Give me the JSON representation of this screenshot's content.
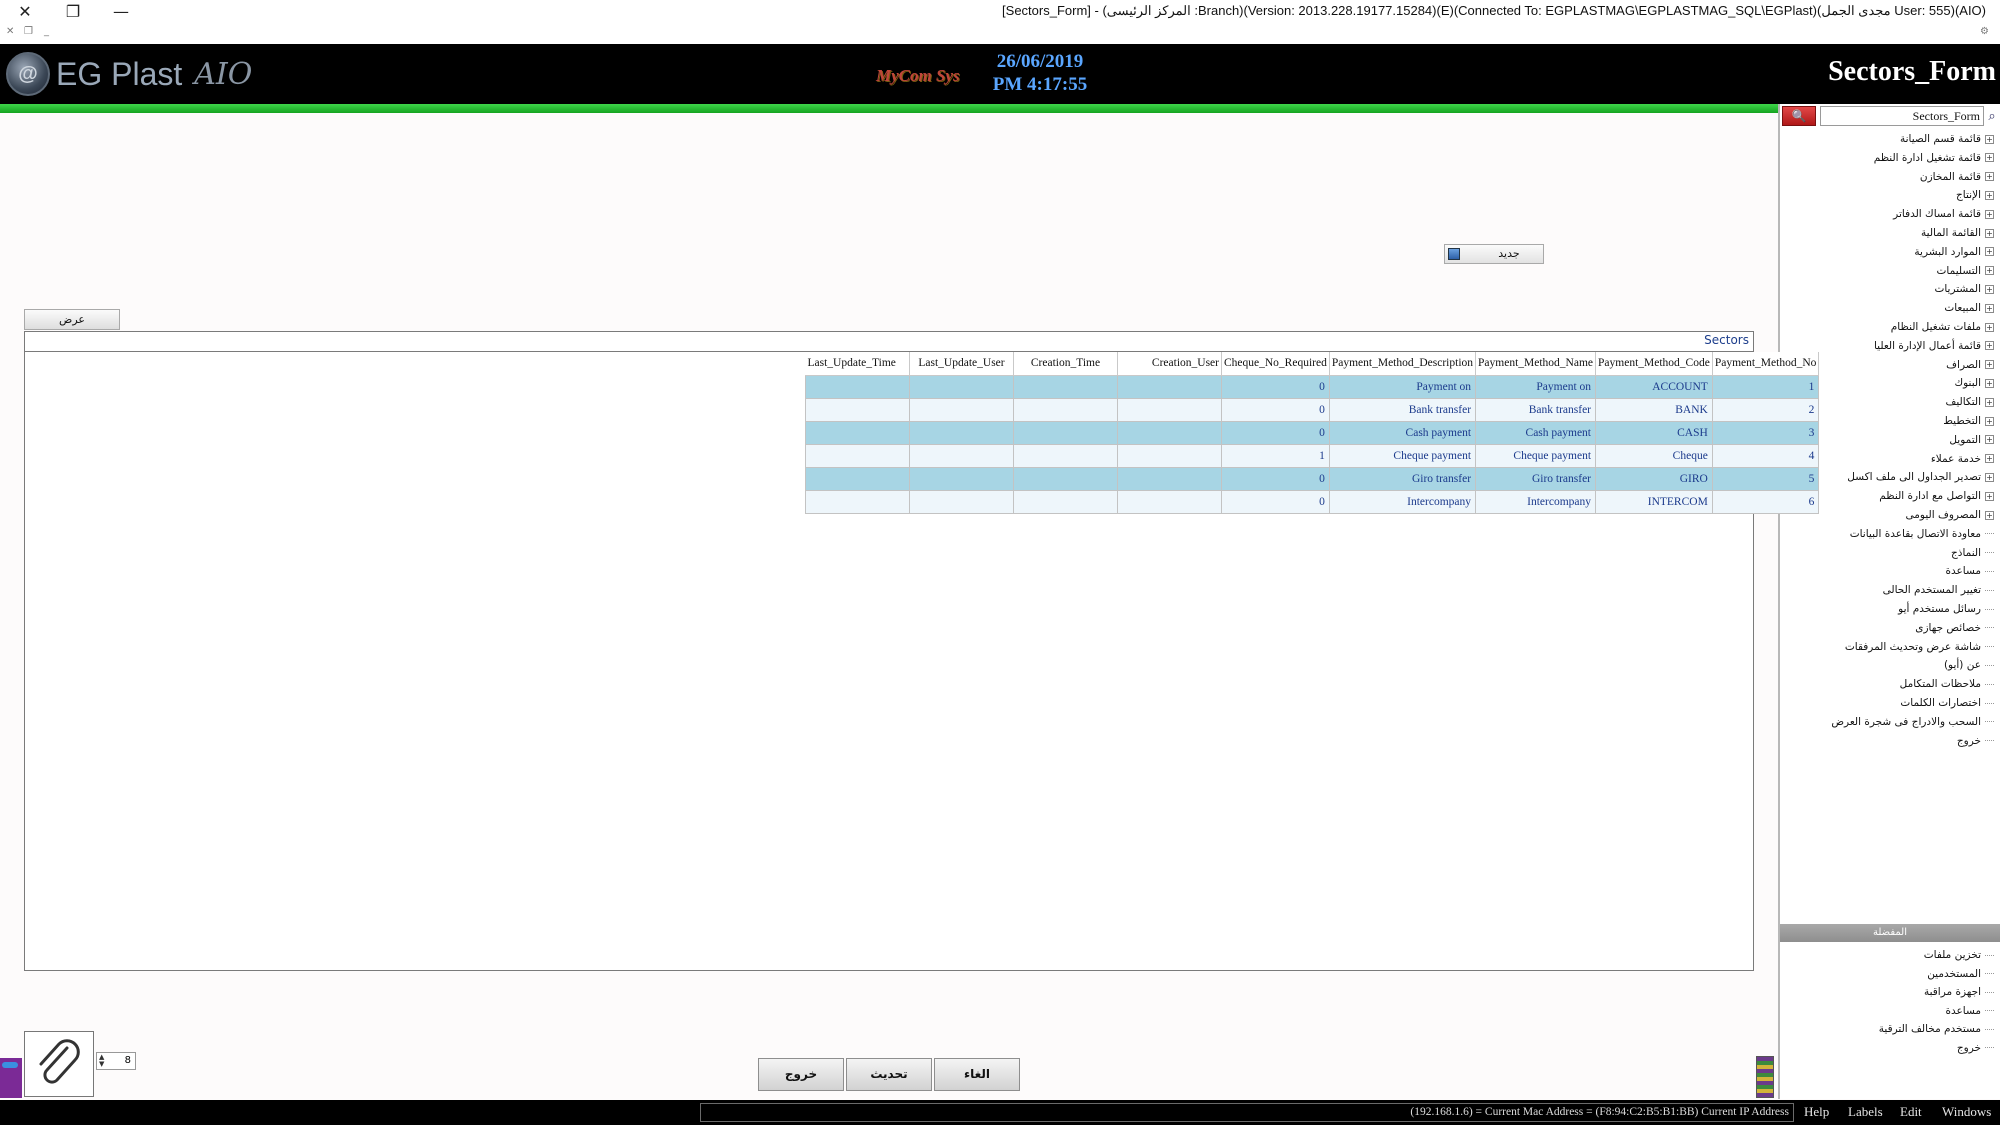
{
  "window": {
    "title": "[Sectors_Form] - (المركز الرئيسى :Branch)(Version: 2013.228.19177.15284)(E)(Connected To: EGPLASTMAG\\EGPLASTMAG_SQL\\EGPlast)(مجدى الجمل User: 555)(AIO)",
    "close_glyph": "✕",
    "restore_glyph": "❐",
    "minimize_glyph": "—"
  },
  "header": {
    "logo_text": "EG Plast",
    "logo_suffix": "AIO",
    "brand": "MyCom Sys",
    "date": "26/06/2019",
    "time": "PM 4:17:55",
    "form_title": "Sectors_Form"
  },
  "sidebar": {
    "search_value": "Sectors_Form",
    "tree": [
      {
        "label": "قائمة قسم الصيانة",
        "expandable": true
      },
      {
        "label": "قائمة تشغيل ادارة النظم",
        "expandable": true
      },
      {
        "label": "قائمة المخازن",
        "expandable": true
      },
      {
        "label": "الإنتاج",
        "expandable": true
      },
      {
        "label": "قائمة امساك الدفاتر",
        "expandable": true
      },
      {
        "label": "القائمة المالية",
        "expandable": true
      },
      {
        "label": "الموارد البشرية",
        "expandable": true
      },
      {
        "label": "التسليمات",
        "expandable": true
      },
      {
        "label": "المشتريات",
        "expandable": true
      },
      {
        "label": "المبيعات",
        "expandable": true
      },
      {
        "label": "ملفات تشغيل النظام",
        "expandable": true
      },
      {
        "label": "قائمة أعمال الإدارة العليا",
        "expandable": true
      },
      {
        "label": "الصراف",
        "expandable": true
      },
      {
        "label": "البنوك",
        "expandable": true
      },
      {
        "label": "التكاليف",
        "expandable": true
      },
      {
        "label": "التخطيط",
        "expandable": true
      },
      {
        "label": "التمويل",
        "expandable": true
      },
      {
        "label": "خدمة عملاء",
        "expandable": true
      },
      {
        "label": "تصدير الجداول الى ملف اكسل",
        "expandable": true
      },
      {
        "label": "التواصل مع ادارة النظم",
        "expandable": true
      },
      {
        "label": "المصروف اليومى",
        "expandable": true
      },
      {
        "label": "معاودة الاتصال بقاعدة البيانات",
        "expandable": false
      },
      {
        "label": "النماذج",
        "expandable": false
      },
      {
        "label": "مساعدة",
        "expandable": false
      },
      {
        "label": "تغيير المستخدم الحالى",
        "expandable": false
      },
      {
        "label": "رسائل مستخدم أيو",
        "expandable": false
      },
      {
        "label": "خصائص جهازى",
        "expandable": false
      },
      {
        "label": "شاشة عرض وتحديث المرفقات",
        "expandable": false
      },
      {
        "label": "عن (أيو)",
        "expandable": false
      },
      {
        "label": "ملاحظات المتكامل",
        "expandable": false
      },
      {
        "label": "اختصارات الكلمات",
        "expandable": false
      },
      {
        "label": "السحب والادراج فى شجرة العرض",
        "expandable": false
      },
      {
        "label": "خروج",
        "expandable": false
      }
    ],
    "favorites_header": "المفضلة",
    "favorites": [
      {
        "label": "تخزين ملفات"
      },
      {
        "label": "المستخدمين"
      },
      {
        "label": "اجهزة مراقبة"
      },
      {
        "label": "مساعدة"
      },
      {
        "label": "مستخدم مخالف الترقية"
      },
      {
        "label": "خروج"
      }
    ]
  },
  "main": {
    "new_button": "جديد",
    "view_button": "عرض",
    "grid_title": "Sectors",
    "columns": [
      "Last_Update_Time",
      "Last_Update_User",
      "Creation_Time",
      "Creation_User",
      "Cheque_No_Required",
      "Payment_Method_Description",
      "Payment_Method_Name",
      "Payment_Method_Code",
      "Payment_Method_No"
    ],
    "rows": [
      {
        "last_update_time": "",
        "last_update_user": "",
        "creation_time": "",
        "creation_user": "",
        "cheque_no_required": "0",
        "description": "Payment on",
        "name": "Payment on",
        "code": "ACCOUNT",
        "no": "1"
      },
      {
        "last_update_time": "",
        "last_update_user": "",
        "creation_time": "",
        "creation_user": "",
        "cheque_no_required": "0",
        "description": "Bank transfer",
        "name": "Bank transfer",
        "code": "BANK",
        "no": "2"
      },
      {
        "last_update_time": "",
        "last_update_user": "",
        "creation_time": "",
        "creation_user": "",
        "cheque_no_required": "0",
        "description": "Cash payment",
        "name": "Cash payment",
        "code": "CASH",
        "no": "3"
      },
      {
        "last_update_time": "",
        "last_update_user": "",
        "creation_time": "",
        "creation_user": "",
        "cheque_no_required": "1",
        "description": "Cheque payment",
        "name": "Cheque payment",
        "code": "Cheque",
        "no": "4"
      },
      {
        "last_update_time": "",
        "last_update_user": "",
        "creation_time": "",
        "creation_user": "",
        "cheque_no_required": "0",
        "description": "Giro transfer",
        "name": "Giro transfer",
        "code": "GIRO",
        "no": "5"
      },
      {
        "last_update_time": "",
        "last_update_user": "",
        "creation_time": "",
        "creation_user": "",
        "cheque_no_required": "0",
        "description": "Intercompany",
        "name": "Intercompany",
        "code": "INTERCOM",
        "no": "6"
      }
    ]
  },
  "footer": {
    "attachment_count": "8",
    "exit_button": "خروج",
    "refresh_button": "تحديث",
    "cancel_button": "الغاء",
    "status_text": "(192.168.1.6) = Current Mac Address = (F8:94:C2:B5:B1:BB) Current IP Address",
    "menu": [
      "Help",
      "Labels",
      "Edit",
      "Windows"
    ]
  },
  "colors": {
    "header_bg": "#000000",
    "accent_green": "#1fb52a",
    "grid_row_alt": "#a7d5e4",
    "clock": "#5aa6ff"
  }
}
